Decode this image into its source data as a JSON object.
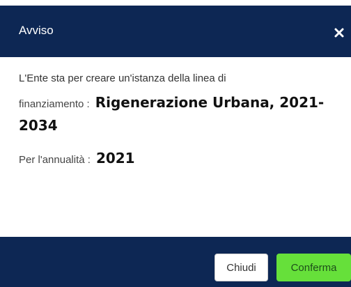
{
  "dialog": {
    "title": "Avviso",
    "close_icon": "close-icon",
    "text_line1": "L'Ente sta per creare un'istanza della linea di",
    "funding_label": "finanziamento :",
    "funding_value_part1": "Rigenerazione Urbana, 2021-",
    "funding_value_part2": "2034",
    "year_label": "Per l'annualità :",
    "year_value": "2021"
  },
  "footer": {
    "cancel_label": "Chiudi",
    "confirm_label": "Conferma"
  },
  "colors": {
    "header_bg": "#0d2754",
    "confirm_bg": "#66e03a"
  }
}
